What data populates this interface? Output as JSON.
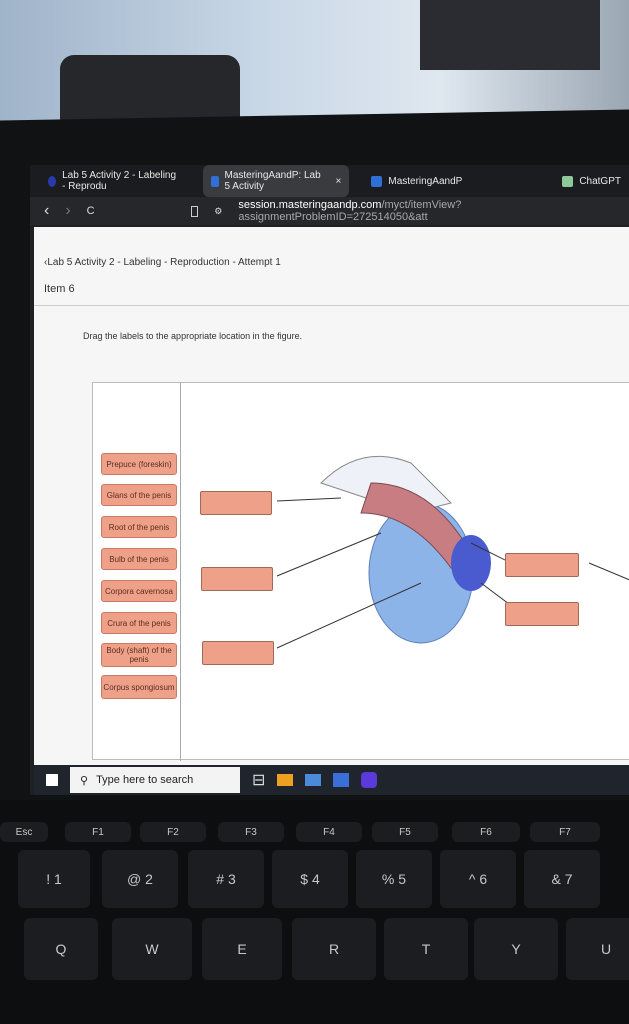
{
  "browser": {
    "tabs": [
      {
        "label": "Lab 5 Activity 2 - Labeling - Reprodu",
        "active": false
      },
      {
        "label": "MasteringAandP: Lab 5 Activity",
        "active": true,
        "close": "×"
      },
      {
        "label": "MasteringAandP",
        "active": false
      },
      {
        "label": "ChatGPT",
        "active": false
      }
    ],
    "nav": {
      "back": "‹",
      "forward": "›",
      "reload": "C"
    },
    "url_host": "session.masteringaandp.com",
    "url_path": "/myct/itemView?assignmentProblemID=272514050&att"
  },
  "page": {
    "breadcrumb": "‹Lab 5 Activity 2 - Labeling - Reproduction - Attempt 1",
    "item": "Item 6",
    "instruction": "Drag the labels to the appropriate location in the figure.",
    "labels": [
      "Prepuce (foreskin)",
      "Glans of the penis",
      "Root of the penis",
      "Bulb of the penis",
      "Corpora cavernosa",
      "Crura of the penis",
      "Body (shaft) of the penis",
      "Corpus spongiosum"
    ]
  },
  "taskbar": {
    "search_placeholder": "Type here to search"
  },
  "keyboard": {
    "fkeys": [
      "Esc",
      "F1",
      "F2",
      "F3",
      "F4",
      "F5",
      "F6",
      "F7"
    ],
    "numbers": [
      [
        "!",
        "1"
      ],
      [
        "@",
        "2"
      ],
      [
        "#",
        "3"
      ],
      [
        "$",
        "4"
      ],
      [
        "%",
        "5"
      ],
      [
        "^",
        "6"
      ],
      [
        "&",
        "7"
      ]
    ],
    "letters": [
      "Q",
      "W",
      "E",
      "R",
      "T",
      "Y",
      "U"
    ]
  },
  "colors": {
    "label_fill": "#eea088",
    "accent": "#2f6fd6"
  }
}
